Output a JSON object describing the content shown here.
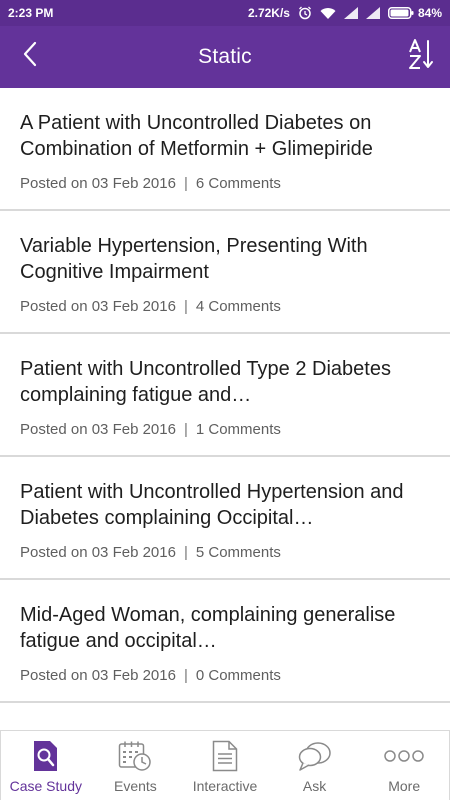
{
  "status_bar": {
    "time": "2:23 PM",
    "network_speed": "2.72K/s",
    "battery": "84%",
    "icons": [
      "alarm-icon",
      "wifi-icon",
      "signal-icon",
      "signal-icon",
      "battery-icon"
    ]
  },
  "header": {
    "title": "Static",
    "back_icon": "chevron-left-icon",
    "sort_icon": "sort-az-icon"
  },
  "posts": [
    {
      "title": "A Patient with Uncontrolled Diabetes on Combination of Metformin + Glimepiride",
      "date": "Posted on 03 Feb 2016",
      "comments": "6 Comments"
    },
    {
      "title": "Variable Hypertension, Presenting With Cognitive Impairment",
      "date": "Posted on 03 Feb 2016",
      "comments": "4 Comments"
    },
    {
      "title": "Patient with Uncontrolled Type 2 Diabetes complaining fatigue and…",
      "date": "Posted on 03 Feb 2016",
      "comments": "1 Comments"
    },
    {
      "title": "Patient with Uncontrolled Hypertension and Diabetes complaining Occipital…",
      "date": "Posted on 03 Feb 2016",
      "comments": "5 Comments"
    },
    {
      "title": "Mid-Aged Woman, complaining generalise fatigue and occipital…",
      "date": "Posted on 03 Feb 2016",
      "comments": "0 Comments"
    }
  ],
  "meta_separator": "|",
  "tabs": [
    {
      "label": "Case Study",
      "icon": "document-search-icon",
      "active": true
    },
    {
      "label": "Events",
      "icon": "calendar-clock-icon",
      "active": false
    },
    {
      "label": "Interactive",
      "icon": "document-icon",
      "active": false
    },
    {
      "label": "Ask",
      "icon": "chat-bubbles-icon",
      "active": false
    },
    {
      "label": "More",
      "icon": "more-dots-icon",
      "active": false
    }
  ],
  "colors": {
    "brand": "#63339a",
    "status_bar": "#5b2d8f",
    "tab_icon": "#8a8a8a",
    "divider": "#d9d9d9"
  }
}
